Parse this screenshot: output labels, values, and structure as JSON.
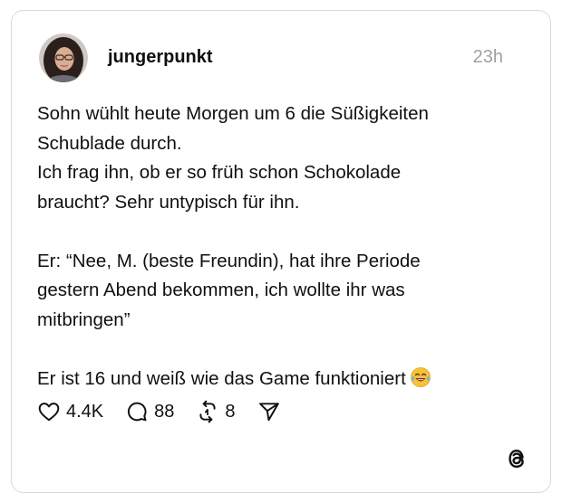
{
  "post": {
    "username": "jungerpunkt",
    "time": "23h",
    "lines": [
      "Sohn wühlt heute Morgen um 6 die Süßigkeiten",
      "Schublade durch.",
      "Ich frag ihn, ob er so früh schon Schokolade",
      "braucht? Sehr untypisch für ihn.",
      "Er: “Nee, M. (beste Freundin), hat ihre Periode",
      "gestern Abend bekommen, ich wollte ihr was",
      "mitbringen”",
      "Er ist 16 und weiß wie das Game funktioniert"
    ],
    "emoji": "face-with-tears-of-joy"
  },
  "actions": {
    "likes": "4.4K",
    "replies": "88",
    "reposts": "8"
  },
  "icons": {
    "like": "heart-icon",
    "reply": "comment-bubble-icon",
    "repost": "repost-icon",
    "share": "send-icon",
    "brand": "threads-logo"
  },
  "colors": {
    "text": "#101010",
    "muted": "#a0a0a0",
    "border": "#d9d9d9"
  }
}
